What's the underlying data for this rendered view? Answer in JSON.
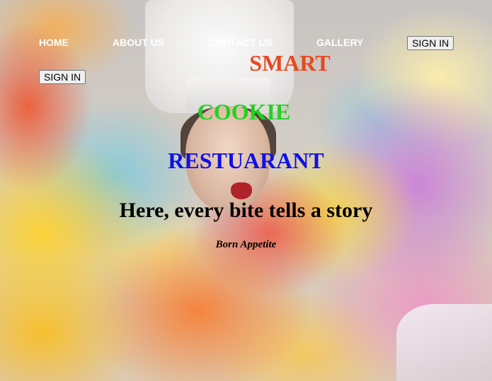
{
  "nav": {
    "home": "HOME",
    "about": "ABOUT US",
    "contact": "CONTACT US",
    "gallery": "GALLERY",
    "signin_primary": "SIGN IN",
    "signin_secondary": "SIGN IN"
  },
  "hero": {
    "title_line1": "SMART",
    "title_line2": "COOKIE",
    "title_line3": "RESTUARANT",
    "tagline": "Here, every bite tells a story",
    "subtagline": "Born Appetite",
    "colors": {
      "line1": "#e8481f",
      "line2": "#1ed41e",
      "line3": "#1010e6",
      "nav_text": "#ffffff"
    },
    "background_image": "chef-in-colorful-powder-explosion"
  }
}
